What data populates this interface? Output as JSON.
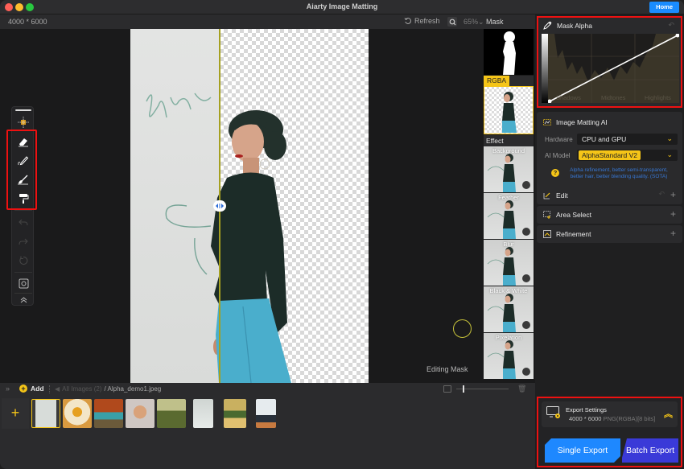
{
  "window": {
    "title": "Aiarty Image Matting",
    "home_label": "Home"
  },
  "toolbar": {
    "dimensions": "4000 * 6000",
    "refresh_label": "Refresh",
    "zoom_level": "65%",
    "view_label": "Mask"
  },
  "canvas": {
    "status": "Editing Mask"
  },
  "tools": [
    {
      "name": "move",
      "icon": "move-icon"
    },
    {
      "name": "eraser",
      "icon": "eraser-icon"
    },
    {
      "name": "pencil",
      "icon": "pencil-icon"
    },
    {
      "name": "brush",
      "icon": "brush-icon"
    },
    {
      "name": "roller",
      "icon": "roller-icon"
    },
    {
      "name": "undo",
      "icon": "undo-icon"
    },
    {
      "name": "redo",
      "icon": "redo-icon"
    },
    {
      "name": "reset",
      "icon": "reset-icon"
    },
    {
      "name": "fit",
      "icon": "fit-screen-icon"
    },
    {
      "name": "collapse",
      "icon": "chevron-up-double-icon"
    }
  ],
  "previews": {
    "rgba_label": "RGBA",
    "effect_label": "Effect",
    "effects": [
      "Background",
      "Feather",
      "Blur",
      "Black & White",
      "Pixelation"
    ]
  },
  "mask_alpha": {
    "title": "Mask Alpha",
    "labels": [
      "Shadows",
      "Midtones",
      "Highlights"
    ]
  },
  "matting": {
    "title": "Image Matting AI",
    "hardware_label": "Hardware",
    "hardware_value": "CPU and GPU",
    "model_label": "AI Model",
    "model_value": "AlphaStandard  V2",
    "help_text": "Alpha refinement, better semi-transparent, better hair, better blending quality. (SOTA)"
  },
  "sections": [
    {
      "title": "Edit",
      "icon": "edit-icon"
    },
    {
      "title": "Area Select",
      "icon": "area-select-icon"
    },
    {
      "title": "Refinement",
      "icon": "refinement-icon"
    }
  ],
  "export": {
    "title": "Export Settings",
    "dimensions": "4000 * 6000",
    "format": "PNG(RGBA)[8 bits]",
    "single_label": "Single Export",
    "batch_label": "Batch Export"
  },
  "bottombar": {
    "add_label": "Add",
    "all_images": "All Images (2)",
    "current_file": "/ Alpha_demo1.jpeg"
  },
  "filmstrip": {
    "thumbnails": [
      {
        "subject": "woman-walking",
        "selected": true
      },
      {
        "subject": "perfume-bottle-flowers",
        "selected": false
      },
      {
        "subject": "teal-car-autumn",
        "selected": false
      },
      {
        "subject": "woman-portrait",
        "selected": false
      },
      {
        "subject": "bicycle",
        "selected": false
      },
      {
        "subject": "bride-veil",
        "selected": false
      },
      {
        "subject": "plant-still-life",
        "selected": false
      },
      {
        "subject": "camera-plant",
        "selected": false
      }
    ]
  },
  "colors": {
    "accent": "#f5c518",
    "primary_button": "#1e88ff",
    "batch_button": "#3a3ad8",
    "highlight_border": "#ee1111"
  }
}
